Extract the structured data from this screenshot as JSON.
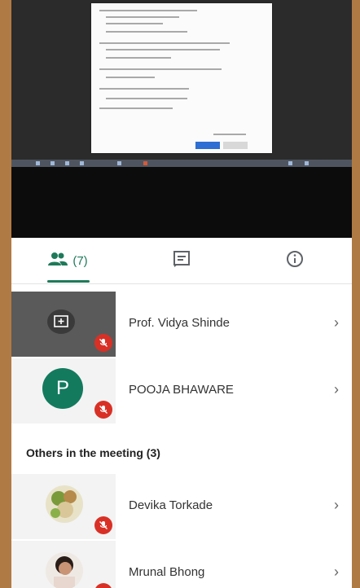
{
  "tabs": [
    {
      "icon": "people-icon",
      "label": "(7)",
      "active": true
    },
    {
      "icon": "chat-icon",
      "label": ""
    },
    {
      "icon": "info-icon",
      "label": ""
    }
  ],
  "participants_in_call": [
    {
      "name": "Prof. Vidya Shinde",
      "tile": "presenting",
      "mic": "muted"
    },
    {
      "name": "POOJA BHAWARE",
      "initial": "P",
      "mic": "muted"
    }
  ],
  "others": {
    "label": "Others in the meeting (3)",
    "people": [
      {
        "name": "Devika Torkade",
        "mic": "muted"
      },
      {
        "name": "Mrunal Bhong",
        "mic": "muted"
      }
    ]
  },
  "chevron": "›",
  "colors": {
    "accent": "#1e7a5a",
    "muted_badge": "#d93025",
    "avatar_bg": "#137a5e"
  }
}
